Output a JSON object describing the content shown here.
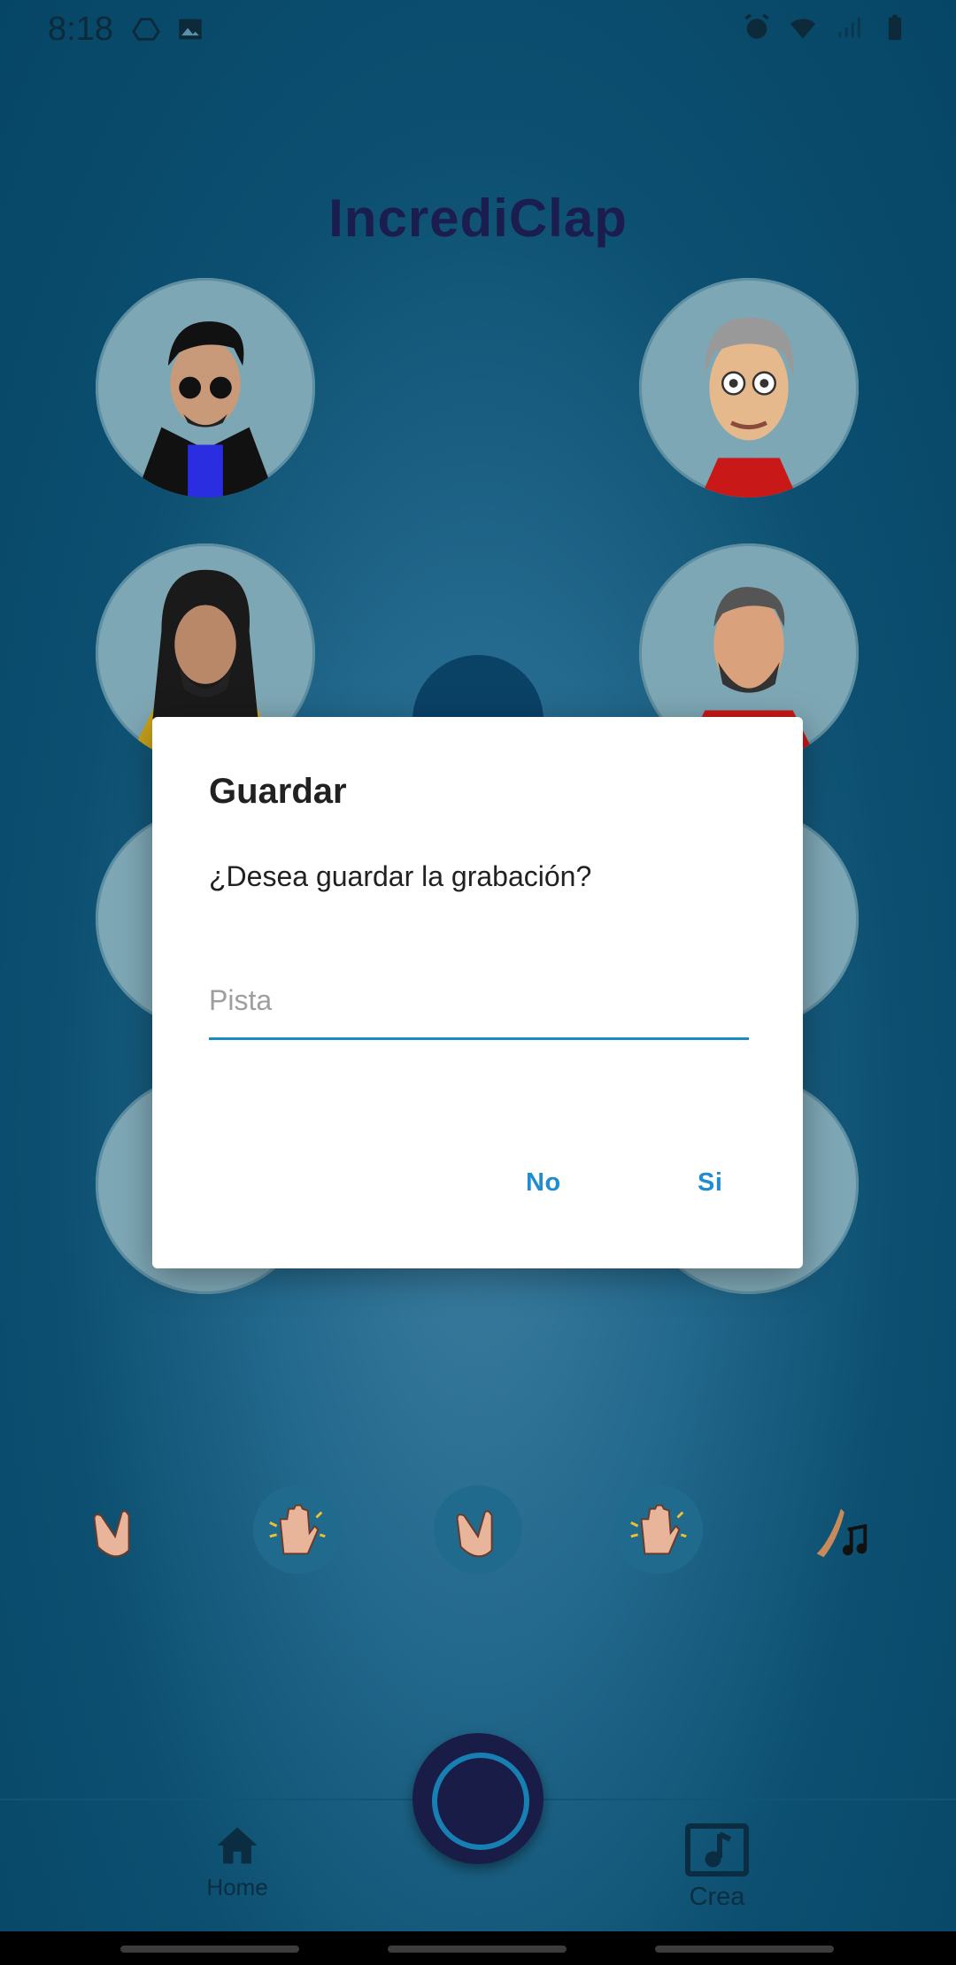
{
  "status_bar": {
    "time": "8:18",
    "left_icons": [
      "drive-icon",
      "image-icon"
    ],
    "right_icons": [
      "alarm-icon",
      "wifi-icon",
      "signal-icon",
      "battery-icon"
    ]
  },
  "app": {
    "title": "IncrediClap"
  },
  "dialog": {
    "title": "Guardar",
    "message": "¿Desea guardar la grabación?",
    "input_placeholder": "Pista",
    "input_value": "",
    "no_label": "No",
    "yes_label": "Si"
  },
  "clap_buttons": [
    "clap-hands-icon",
    "raised-hand-icon",
    "clap-hands-icon",
    "raised-hand-icon",
    "music-notes-icon"
  ],
  "bottom_nav": {
    "home_label": "Home",
    "crea_label": "Crea"
  },
  "colors": {
    "accent": "#1f8dd0",
    "title": "#1a1d4e",
    "background": "#0c4f70"
  }
}
